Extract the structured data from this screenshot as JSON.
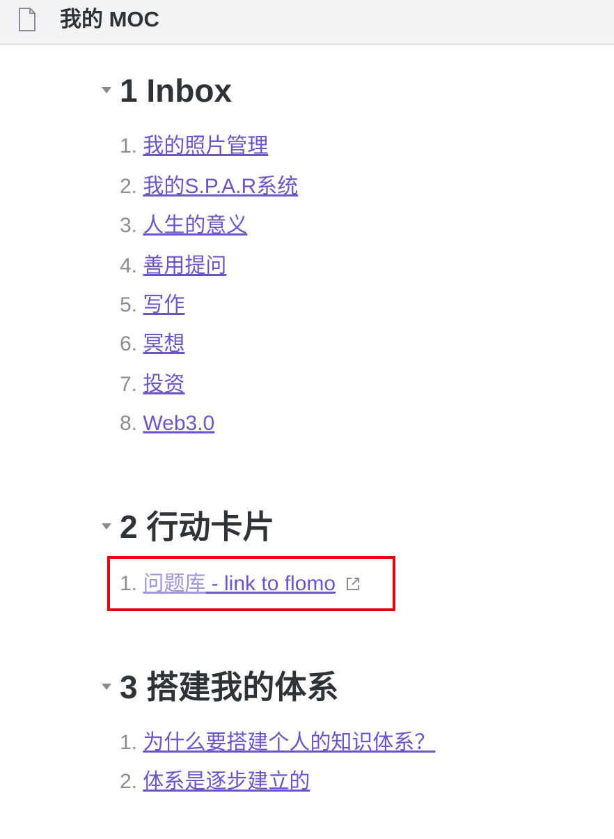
{
  "header": {
    "title": "我的 MOC",
    "icon": "document-icon"
  },
  "sections": [
    {
      "heading": "1 Inbox",
      "items": [
        {
          "num": "1.",
          "text": "我的照片管理"
        },
        {
          "num": "2.",
          "text": "我的S.P.A.R系统"
        },
        {
          "num": "3.",
          "text": "人生的意义"
        },
        {
          "num": "4.",
          "text": "善用提问"
        },
        {
          "num": "5.",
          "text": "写作"
        },
        {
          "num": "6.",
          "text": "冥想"
        },
        {
          "num": "7.",
          "text": "投资"
        },
        {
          "num": "8.",
          "text": "Web3.0"
        }
      ]
    },
    {
      "heading": "2 行动卡片",
      "items": [
        {
          "num": "1.",
          "faded_text": "问题库",
          "text": " - link to flomo",
          "external": true
        }
      ]
    },
    {
      "heading": "3 搭建我的体系",
      "items": [
        {
          "num": "1.",
          "text": "为什么要搭建个人的知识体系？"
        },
        {
          "num": "2.",
          "text": "体系是逐步建立的"
        }
      ]
    }
  ],
  "colors": {
    "link": "#6d54c9",
    "link_faded": "#a493dd",
    "highlight_border": "#e8000b"
  }
}
